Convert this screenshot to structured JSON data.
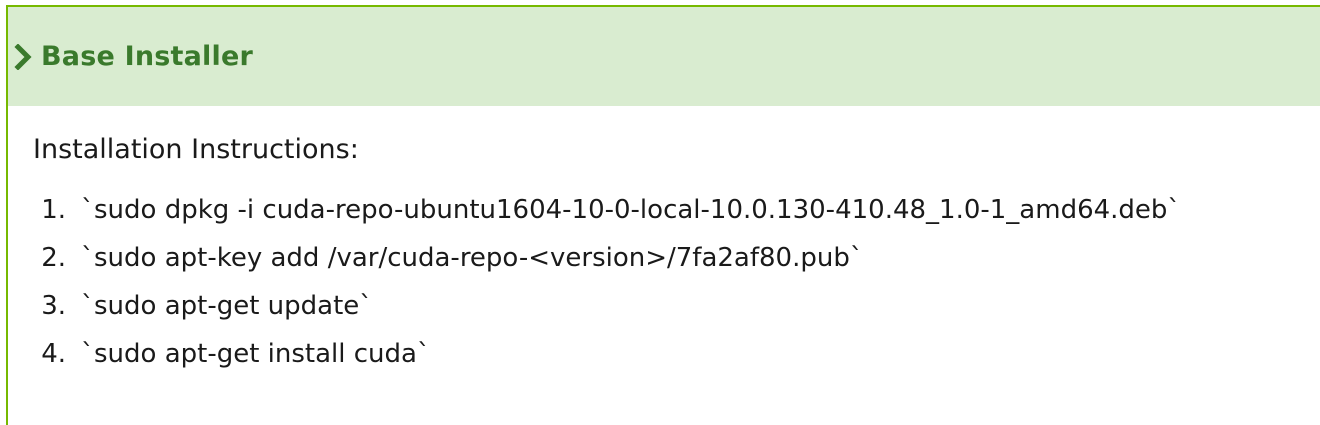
{
  "panel": {
    "title": "Base Installer",
    "icon": "chevron-right-icon",
    "accent_color": "#76b900",
    "header_bg": "#d9ecd0",
    "title_color": "#3a7a2c"
  },
  "body": {
    "intro": "Installation Instructions:",
    "steps": [
      {
        "num": "1.",
        "text": "`sudo dpkg -i cuda-repo-ubuntu1604-10-0-local-10.0.130-410.48_1.0-1_amd64.deb`"
      },
      {
        "num": "2.",
        "text": "`sudo apt-key add /var/cuda-repo-<version>/7fa2af80.pub`"
      },
      {
        "num": "3.",
        "text": "`sudo apt-get update`"
      },
      {
        "num": "4.",
        "text": "`sudo apt-get install cuda`"
      }
    ]
  }
}
